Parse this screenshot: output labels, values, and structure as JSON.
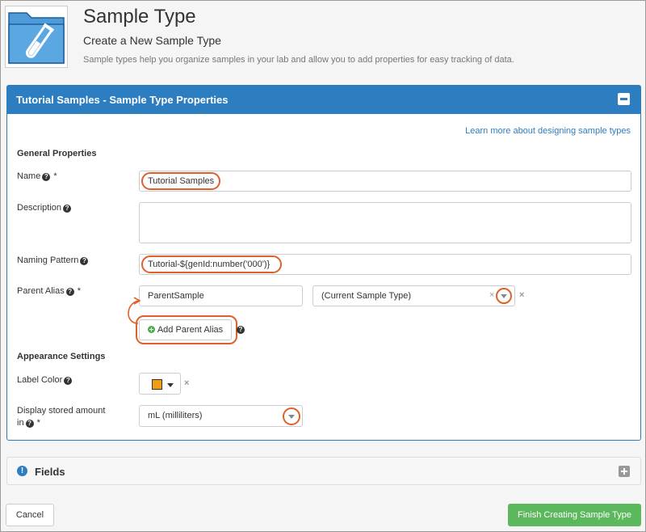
{
  "header": {
    "title": "Sample Type",
    "subtitle": "Create a New Sample Type",
    "description": "Sample types help you organize samples in your lab and allow you to add properties for easy tracking of data.",
    "icon": "sample-folder-icon"
  },
  "panel": {
    "title": "Tutorial Samples - Sample Type Properties",
    "learn_more": "Learn more about designing sample types",
    "general_heading": "General Properties",
    "name_label": "Name",
    "name_value": "Tutorial Samples",
    "description_label": "Description",
    "description_value": "",
    "naming_pattern_label": "Naming Pattern",
    "naming_pattern_value": "Tutorial-${genId:number('000')}",
    "parent_alias_label": "Parent Alias",
    "parent_alias_value": "ParentSample",
    "parent_type_value": "(Current Sample Type)",
    "add_parent_alias": "Add Parent Alias",
    "appearance_heading": "Appearance Settings",
    "label_color_label": "Label Color",
    "label_color_value": "#f39c12",
    "display_amount_label_1": "Display stored amount",
    "display_amount_label_2": "in",
    "display_amount_value": "mL (milliliters)",
    "required_mark": "*",
    "clear_mark": "×"
  },
  "fields_panel": {
    "title": "Fields",
    "info_glyph": "!"
  },
  "footer": {
    "cancel": "Cancel",
    "finish": "Finish Creating Sample Type"
  },
  "colors": {
    "accent": "#2d7ec0",
    "highlight": "#e0602c",
    "success": "#5cb85c"
  }
}
